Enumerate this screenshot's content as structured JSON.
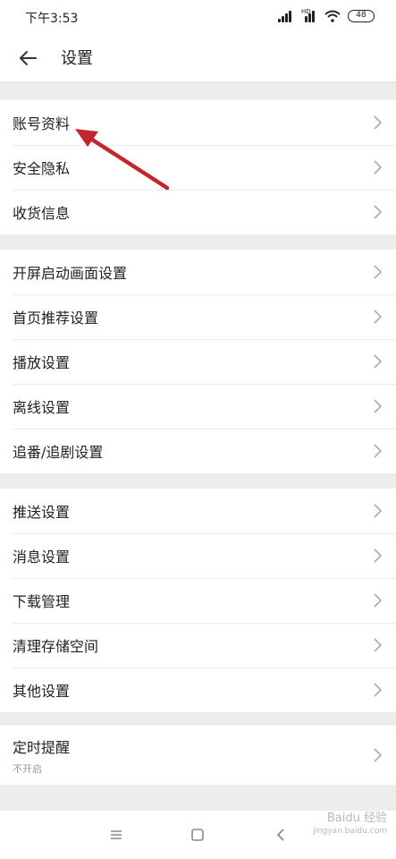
{
  "status_bar": {
    "time": "下午3:53",
    "hd_label": "HD",
    "battery": "48"
  },
  "header": {
    "title": "设置"
  },
  "groups": [
    {
      "items": [
        {
          "label": "账号资料"
        },
        {
          "label": "安全隐私"
        },
        {
          "label": "收货信息"
        }
      ]
    },
    {
      "items": [
        {
          "label": "开屏启动画面设置"
        },
        {
          "label": "首页推荐设置"
        },
        {
          "label": "播放设置"
        },
        {
          "label": "离线设置"
        },
        {
          "label": "追番/追剧设置"
        }
      ]
    },
    {
      "items": [
        {
          "label": "推送设置"
        },
        {
          "label": "消息设置"
        },
        {
          "label": "下载管理"
        },
        {
          "label": "清理存储空间"
        },
        {
          "label": "其他设置"
        }
      ]
    },
    {
      "items": [
        {
          "label": "定时提醒",
          "sub": "不开启"
        }
      ]
    }
  ],
  "watermark": {
    "text": "Baidu 经验",
    "url": "jingyan.baidu.com"
  },
  "colors": {
    "annotation_arrow": "#c0262b",
    "background": "#ededed",
    "chevron": "#aaaaaa"
  }
}
